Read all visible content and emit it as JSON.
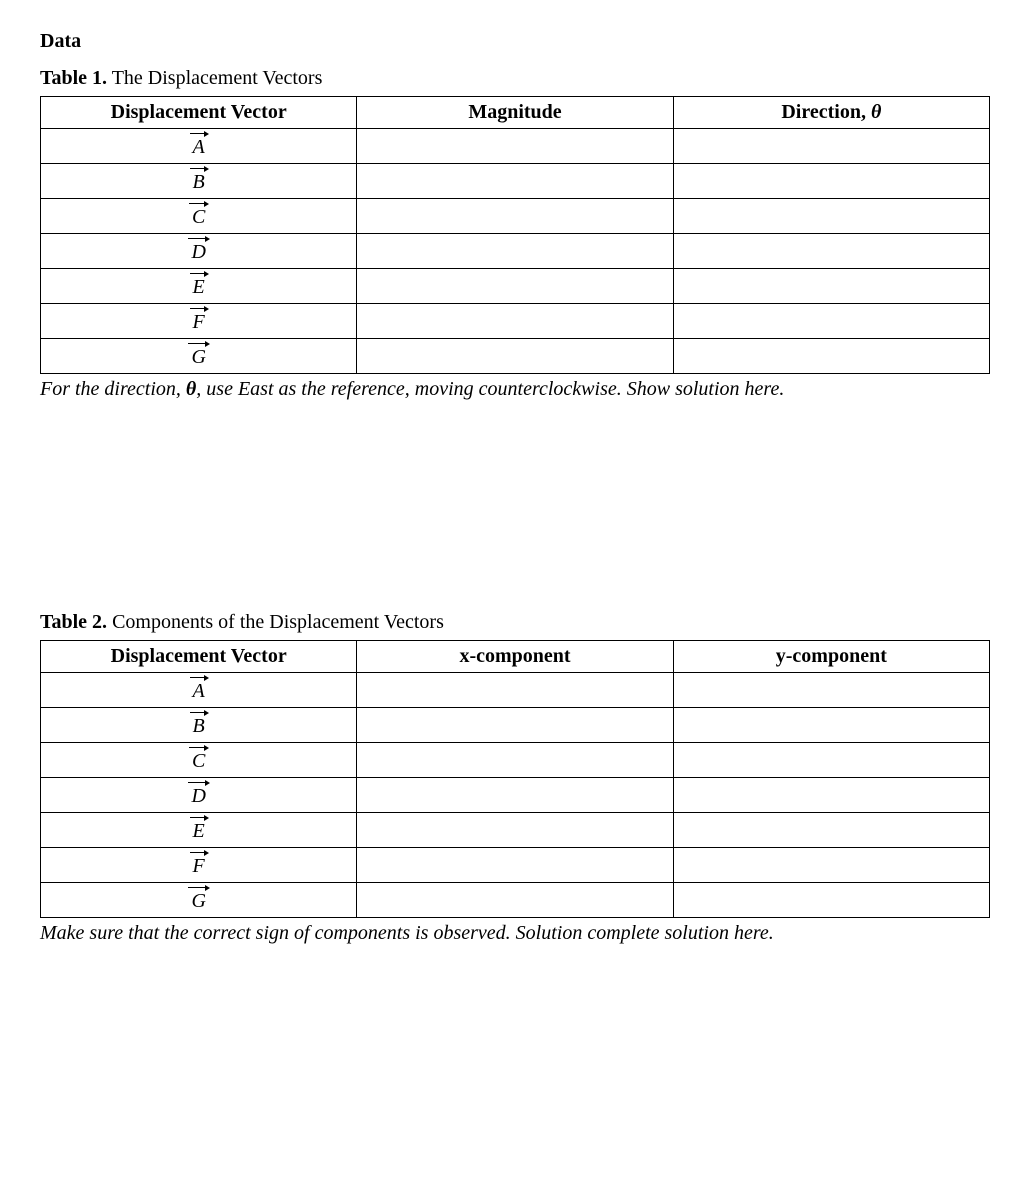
{
  "heading": "Data",
  "table1": {
    "caption_label": "Table 1.",
    "caption_text": " The Displacement Vectors",
    "headers": {
      "col1": "Displacement Vector",
      "col2": "Magnitude",
      "col3_prefix": "Direction, ",
      "col3_symbol": "θ"
    },
    "rows": [
      {
        "vector": "A",
        "magnitude": "",
        "direction": ""
      },
      {
        "vector": "B",
        "magnitude": "",
        "direction": ""
      },
      {
        "vector": "C",
        "magnitude": "",
        "direction": ""
      },
      {
        "vector": "D",
        "magnitude": "",
        "direction": ""
      },
      {
        "vector": "E",
        "magnitude": "",
        "direction": ""
      },
      {
        "vector": "F",
        "magnitude": "",
        "direction": ""
      },
      {
        "vector": "G",
        "magnitude": "",
        "direction": ""
      }
    ],
    "note_prefix": "For the direction, ",
    "note_symbol": "θ",
    "note_suffix": ", use East as the reference, moving counterclockwise. Show solution here."
  },
  "table2": {
    "caption_label": "Table 2.",
    "caption_text": " Components of the Displacement Vectors",
    "headers": {
      "col1": "Displacement Vector",
      "col2": "x-component",
      "col3": "y-component"
    },
    "rows": [
      {
        "vector": "A",
        "x": "",
        "y": ""
      },
      {
        "vector": "B",
        "x": "",
        "y": ""
      },
      {
        "vector": "C",
        "x": "",
        "y": ""
      },
      {
        "vector": "D",
        "x": "",
        "y": ""
      },
      {
        "vector": "E",
        "x": "",
        "y": ""
      },
      {
        "vector": "F",
        "x": "",
        "y": ""
      },
      {
        "vector": "G",
        "x": "",
        "y": ""
      }
    ],
    "note": "Make sure that the correct sign of components is observed. Solution complete solution here."
  }
}
